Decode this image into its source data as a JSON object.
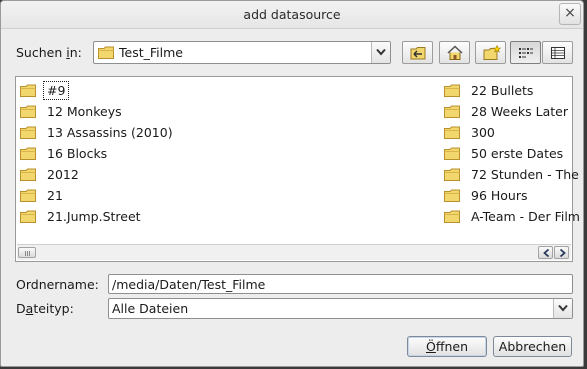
{
  "window": {
    "title": "add datasource",
    "close_glyph": "×"
  },
  "lookin": {
    "label_pre": "Suchen ",
    "label_mn": "i",
    "label_post": "n:",
    "value": "Test_Filme"
  },
  "toolbar": {
    "buttons": [
      {
        "name": "back-button",
        "icon": "folder-back-icon"
      },
      {
        "name": "home-button",
        "icon": "home-icon"
      },
      {
        "name": "new-folder-button",
        "icon": "new-folder-icon"
      },
      {
        "name": "list-view-button",
        "icon": "list-view-icon",
        "pressed": true
      },
      {
        "name": "detail-view-button",
        "icon": "detail-view-icon"
      }
    ]
  },
  "files": {
    "column1": [
      "#9",
      "12 Monkeys",
      "13 Assassins (2010)",
      "16 Blocks",
      "2012",
      "21",
      "21.Jump.Street"
    ],
    "column2": [
      "22 Bullets",
      "28 Weeks Later",
      "300",
      "50 erste Dates",
      "72 Stunden - The",
      "96 Hours",
      "A-Team - Der Film"
    ],
    "focused_index": 0
  },
  "foldername": {
    "label": "Ordnername:",
    "value": "/media/Daten/Test_Filme"
  },
  "filetype": {
    "label_pre": "D",
    "label_mn": "a",
    "label_post": "teityp:",
    "value": "Alle Dateien"
  },
  "actions": {
    "open_mn": "Ö",
    "open_rest": "ffnen",
    "cancel_label": "Abbrechen"
  },
  "colors": {
    "folder": "#f2d66e",
    "folder_edge": "#b9912c",
    "accent": "#c6d6e8"
  }
}
